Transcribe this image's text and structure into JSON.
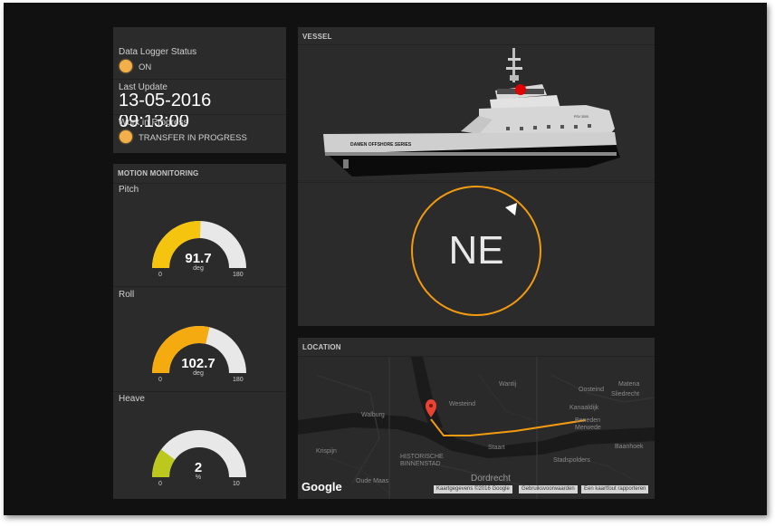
{
  "status": {
    "data_logger_label": "Data Logger Status",
    "data_logger_value": "ON",
    "last_update_label": "Last Update",
    "last_update_value": "13-05-2016 09:13:00",
    "wip_label": "Work in Progress",
    "wip_value": "TRANSFER IN PROGRESS",
    "led_color": "#f3b04a"
  },
  "motion": {
    "title": "MOTION MONITORING",
    "pitch": {
      "label": "Pitch",
      "value": "91.7",
      "unit": "deg",
      "min": "0",
      "max": "180",
      "num": 91.7,
      "range": 180,
      "color": "#f5c40f"
    },
    "roll": {
      "label": "Roll",
      "value": "102.7",
      "unit": "deg",
      "min": "0",
      "max": "180",
      "num": 102.7,
      "range": 180,
      "color": "#f5aa10"
    },
    "heave": {
      "label": "Heave",
      "value": "2",
      "unit": "%",
      "min": "0",
      "max": "10",
      "num": 2,
      "range": 10,
      "color": "#bcc81e"
    }
  },
  "vessel": {
    "title": "VESSEL",
    "hull_text": "DAMEN OFFSHORE SERIES",
    "stern_text": "PSV 3000",
    "heading": "NE",
    "compass_color": "#f29b11"
  },
  "location": {
    "title": "LOCATION",
    "labels": {
      "westeind": "Westeind",
      "walburg": "Walburg",
      "oosteind": "Oosteind",
      "matena": "Matena",
      "staart": "Staart",
      "historische": "HISTORISCHE",
      "binnenstad": "BINNENSTAD",
      "dordrecht": "Dordrecht",
      "oude_maas": "Oude Maas",
      "merwede1": "Beneden",
      "merwede2": "Merwede",
      "sliedrecht": "Sliedrecht",
      "kanaalweg": "Kanaaldijk",
      "baanhoek": "Baanhoek",
      "wantij": "Wantij",
      "stadspolders": "Stadspolders",
      "krispijn": "Krispijn"
    },
    "google": "Google",
    "attribution": [
      "Kaartgegevens ©2016 Google",
      "Gebruiksvoorwaarden",
      "Een kaartfout rapporteren"
    ],
    "route_color": "#f29b11",
    "pin_color": "#e84335"
  }
}
